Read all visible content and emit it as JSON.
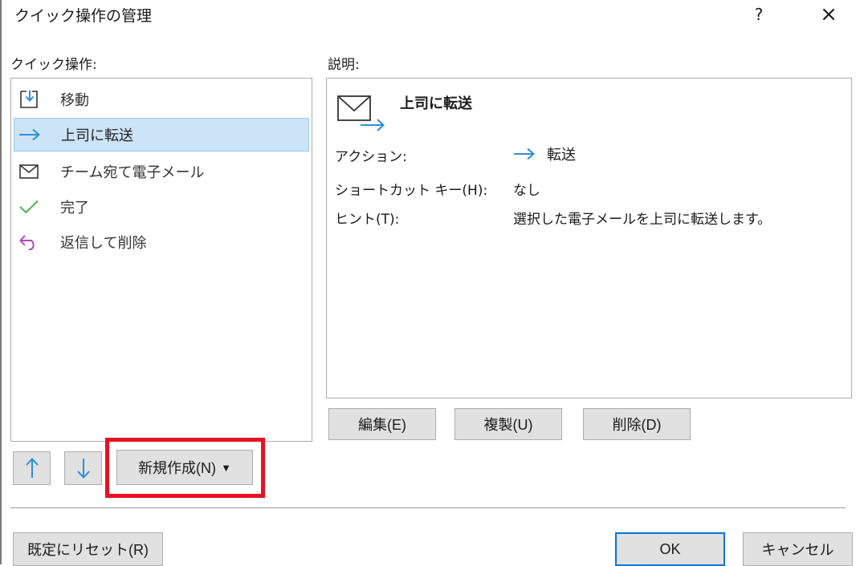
{
  "dialog": {
    "title": "クイック操作の管理",
    "help_label": "?",
    "close_label": "×"
  },
  "list": {
    "label": "クイック操作:",
    "items": [
      {
        "label": "移動",
        "icon": "move-to-folder-icon"
      },
      {
        "label": "上司に転送",
        "icon": "forward-arrow-icon",
        "selected": true
      },
      {
        "label": "チーム宛て電子メール",
        "icon": "envelope-icon"
      },
      {
        "label": "完了",
        "icon": "checkmark-icon"
      },
      {
        "label": "返信して削除",
        "icon": "reply-arrow-icon"
      }
    ]
  },
  "description": {
    "label": "説明:",
    "title": "上司に転送",
    "action_label": "アクション:",
    "action_value": "転送",
    "shortcut_label": "ショートカット キー(H):",
    "shortcut_value": "なし",
    "hint_label": "ヒント(T):",
    "hint_value": "選択した電子メールを上司に転送します。"
  },
  "buttons": {
    "edit": "編集(E)",
    "duplicate": "複製(U)",
    "delete": "削除(D)",
    "new": "新規作成(N)",
    "reset": "既定にリセット(R)",
    "ok": "OK",
    "cancel": "キャンセル"
  },
  "colors": {
    "selection_bg": "#cce4f7",
    "accent_blue": "#0078d7",
    "icon_blue": "#2b8fd6",
    "check_green": "#4caf50",
    "reply_purple": "#b146c2",
    "highlight_red": "#e81123"
  }
}
